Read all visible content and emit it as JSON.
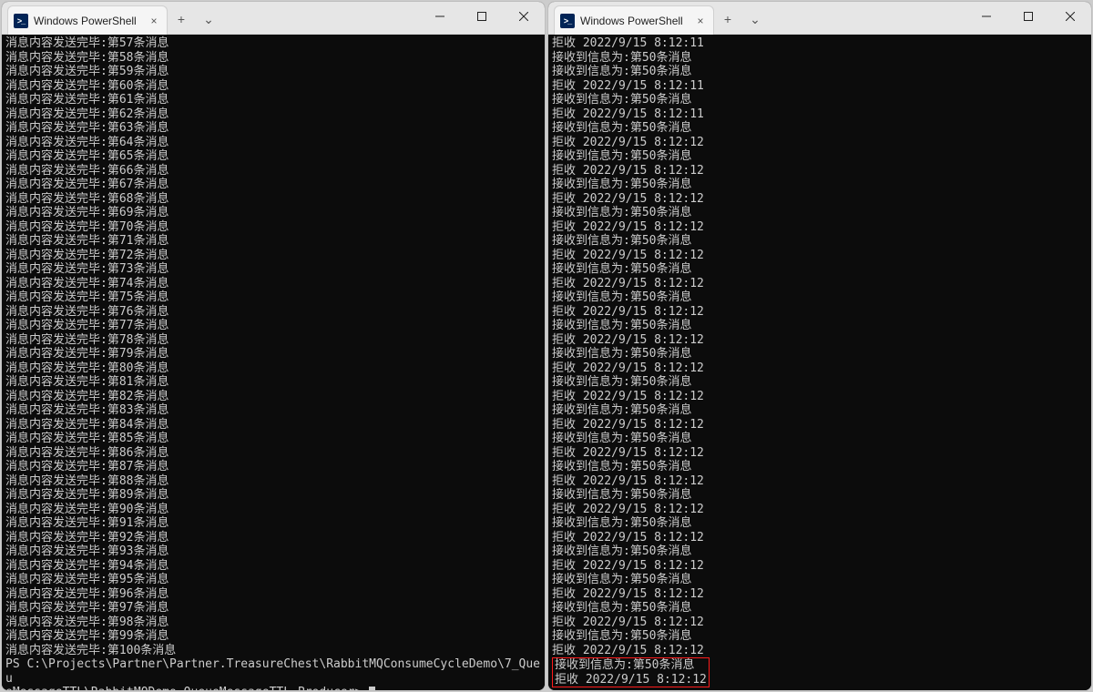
{
  "windows": {
    "left": {
      "tab_title": "Windows PowerShell",
      "producer_prefix": "消息内容发送完毕:第",
      "producer_suffix": "条消息",
      "producer_start": 57,
      "producer_end": 100,
      "prompt_line1": "PS C:\\Projects\\Partner\\Partner.TreasureChest\\RabbitMQConsumeCycleDemo\\7_Queu",
      "prompt_line2": "eMessageTTL\\RabbitMQDemo.QueueMessageTTL.Producer> "
    },
    "right": {
      "tab_title": "Windows PowerShell",
      "receive_line": "接收到信息为:第50条消息",
      "reject_prefix": "拒收 2022/9/15 8:12:",
      "pairs": [
        {
          "first_is_reject": true,
          "sec": "11"
        },
        {
          "sec": "11"
        },
        {
          "sec": "11"
        },
        {
          "sec": "12"
        },
        {
          "sec": "12"
        },
        {
          "sec": "12"
        },
        {
          "sec": "12"
        },
        {
          "sec": "12"
        },
        {
          "sec": "12"
        },
        {
          "sec": "12"
        },
        {
          "sec": "12"
        },
        {
          "sec": "12"
        },
        {
          "sec": "12"
        },
        {
          "sec": "12"
        },
        {
          "sec": "12"
        },
        {
          "sec": "12"
        },
        {
          "sec": "12"
        },
        {
          "sec": "12"
        },
        {
          "sec": "12"
        },
        {
          "sec": "12"
        },
        {
          "sec": "12"
        },
        {
          "sec": "12"
        },
        {
          "sec": "12",
          "highlight": true
        }
      ]
    }
  },
  "icons": {
    "close_glyph": "×",
    "plus_glyph": "+",
    "chevron_glyph": "⌄"
  }
}
